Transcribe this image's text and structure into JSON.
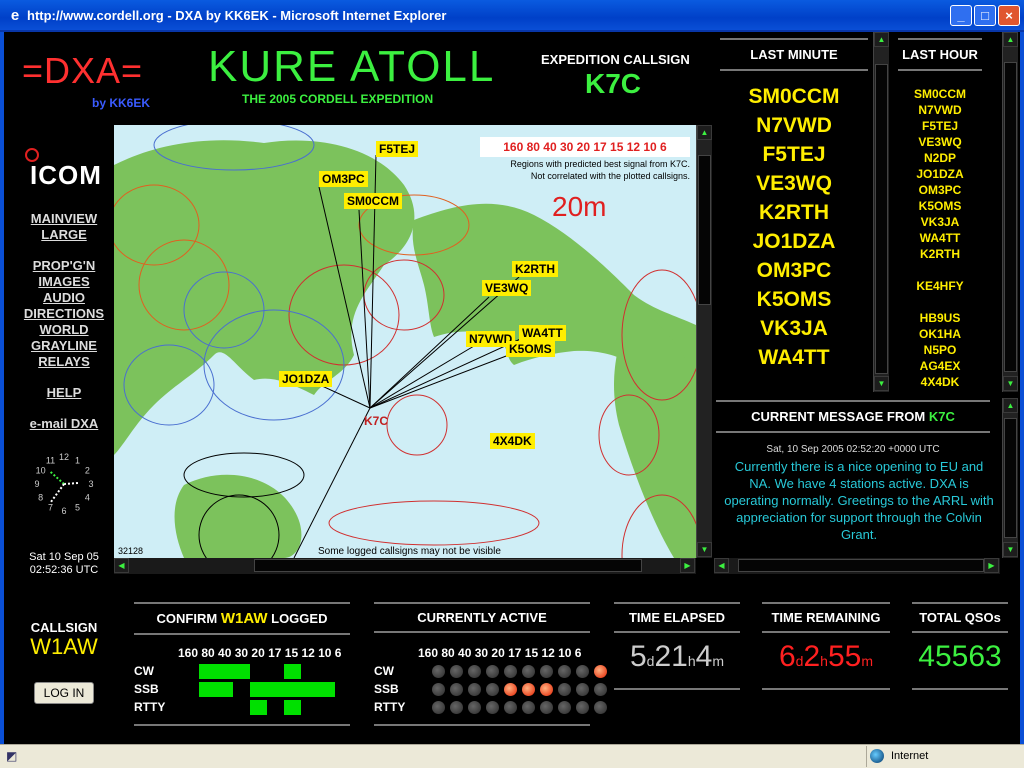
{
  "window": {
    "title": "http://www.cordell.org - DXA by KK6EK - Microsoft Internet Explorer"
  },
  "status": {
    "zone": "Internet"
  },
  "header": {
    "logo": "=DXA=",
    "by": "by KK6EK",
    "site": "KURE ATOLL",
    "subtitle": "THE 2005 CORDELL EXPEDITION",
    "exp_label": "EXPEDITION CALLSIGN",
    "exp_call": "K7C"
  },
  "sponsor": "ICOM",
  "nav": {
    "group1": [
      "MAINVIEW",
      "LARGE"
    ],
    "group2": [
      "PROP'G'N",
      "IMAGES",
      "AUDIO",
      "DIRECTIONS",
      "WORLD",
      "GRAYLINE",
      "RELAYS"
    ],
    "help": "HELP",
    "email": "e-mail DXA"
  },
  "clock": {
    "date": "Sat 10 Sep 05",
    "time": "02:52:36 UTC",
    "numbers": [
      "12",
      "1",
      "2",
      "3",
      "4",
      "5",
      "6",
      "7",
      "8",
      "9",
      "10",
      "11"
    ]
  },
  "map": {
    "bands_label": "160 80 40 30 20 17 15 12 10 6",
    "note1": "Regions with predicted best signal from K7C.",
    "note2": "Not correlated with the plotted callsigns.",
    "band": "20m",
    "counter": "32128",
    "footer": "Some logged callsigns may not be visible",
    "origin": "K7C",
    "callsigns": [
      "F5TEJ",
      "OM3PC",
      "SM0CCM",
      "K2RTH",
      "VE3WQ",
      "WA4TT",
      "N7VWD",
      "K5OMS",
      "JO1DZA",
      "4X4DK"
    ]
  },
  "last_minute": {
    "title": "LAST MINUTE",
    "items": [
      "SM0CCM",
      "N7VWD",
      "F5TEJ",
      "VE3WQ",
      "K2RTH",
      "JO1DZA",
      "OM3PC",
      "K5OMS",
      "VK3JA",
      "WA4TT"
    ]
  },
  "last_hour": {
    "title": "LAST HOUR",
    "items": [
      "SM0CCM",
      "N7VWD",
      "F5TEJ",
      "VE3WQ",
      "N2DP",
      "JO1DZA",
      "OM3PC",
      "K5OMS",
      "VK3JA",
      "WA4TT",
      "K2RTH",
      "",
      "KE4HFY",
      "",
      "HB9US",
      "OK1HA",
      "N5PO",
      "AG4EX",
      "4X4DK"
    ]
  },
  "message": {
    "title": "CURRENT MESSAGE FROM",
    "from": "K7C",
    "timestamp": "Sat, 10 Sep 2005 02:52:20 +0000 UTC",
    "body": "Currently there is a nice opening to  EU and NA. We have 4 stations active. DXA is operating normally. Greetings to the ARRL with appreciation for support through the Colvin Grant."
  },
  "callsign_box": {
    "label": "CALLSIGN",
    "call": "W1AW",
    "login": "LOG IN"
  },
  "confirm": {
    "prefix": "CONFIRM",
    "call": "W1AW",
    "suffix": "LOGGED",
    "bands": [
      "160",
      "80",
      "40",
      "30",
      "20",
      "17",
      "15",
      "12",
      "10",
      "6"
    ],
    "modes": [
      "CW",
      "SSB",
      "RTTY"
    ],
    "grid": [
      [
        0,
        0,
        0,
        1,
        0,
        0,
        1,
        0,
        0,
        0
      ],
      [
        0,
        0,
        1,
        1,
        0,
        0,
        0,
        0,
        0,
        0
      ],
      [
        0,
        0,
        0,
        0,
        0,
        0,
        0,
        0,
        0,
        0
      ]
    ]
  },
  "active": {
    "title": "CURRENTLY ACTIVE",
    "bands": [
      "160",
      "80",
      "40",
      "30",
      "20",
      "17",
      "15",
      "12",
      "10",
      "6"
    ],
    "modes": [
      "CW",
      "SSB",
      "RTTY"
    ],
    "grid": [
      [
        0,
        0,
        0,
        0,
        0,
        0,
        0,
        0,
        0,
        1
      ],
      [
        0,
        0,
        0,
        0,
        1,
        1,
        1,
        0,
        0,
        0
      ],
      [
        0,
        0,
        0,
        0,
        0,
        0,
        0,
        0,
        0,
        0
      ]
    ]
  },
  "elapsed": {
    "title": "TIME ELAPSED",
    "d": "5",
    "h": "21",
    "m": "4",
    "du": "d",
    "hu": "h",
    "mu": "m",
    "color": "#cccccc"
  },
  "remaining": {
    "title": "TIME REMAINING",
    "d": "6",
    "h": "2",
    "m": "55",
    "du": "d",
    "hu": "h",
    "mu": "m",
    "color": "#ff2020"
  },
  "total": {
    "title": "TOTAL QSOs",
    "value": "45563",
    "color": "#3cf040"
  }
}
